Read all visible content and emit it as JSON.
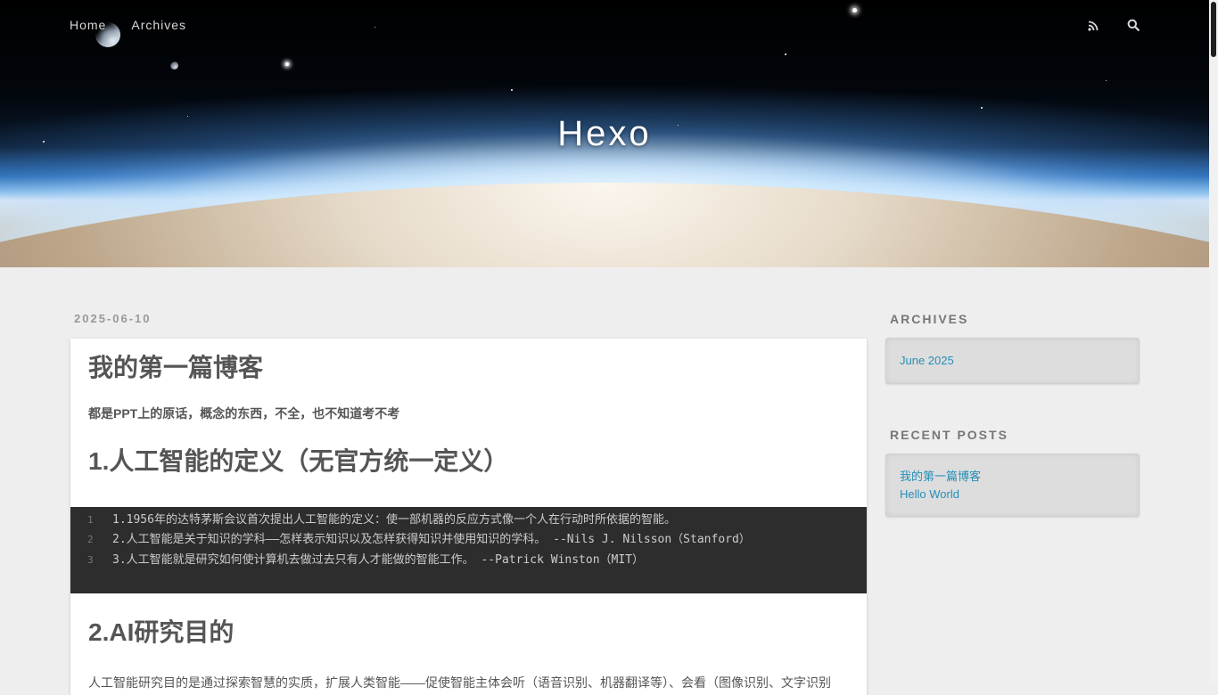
{
  "nav": {
    "home": "Home",
    "archives": "Archives",
    "rss_icon": "rss-icon",
    "search_icon": "search-icon"
  },
  "site": {
    "title": "Hexo"
  },
  "post": {
    "date": "2025-06-10",
    "title": "我的第一篇博客",
    "subtitle": "都是PPT上的原话，概念的东西，不全，也不知道考不考",
    "section1": "1.人工智能的定义（无官方统一定义）",
    "code_lines": [
      {
        "num": "1",
        "text": "1.1956年的达特茅斯会议首次提出人工智能的定义：使一部机器的反应方式像一个人在行动时所依据的智能。"
      },
      {
        "num": "2",
        "text": "2.人工智能是关于知识的学科——怎样表示知识以及怎样获得知识并使用知识的学科。  --Nils J. Nilsson（Stanford）"
      },
      {
        "num": "3",
        "text": "3.人工智能就是研究如何使计算机去做过去只有人才能做的智能工作。 --Patrick Winston（MIT）"
      }
    ],
    "section2": "2.AI研究目的",
    "paragraph": "人工智能研究目的是通过探索智慧的实质，扩展人类智能——促使智能主体会听（语音识别、机器翻译等）、会看（图像识别、文字识别"
  },
  "sidebar": {
    "archives_title": "ARCHIVES",
    "archives": [
      "June 2025"
    ],
    "recent_title": "RECENT POSTS",
    "recent": [
      "我的第一篇博客",
      "Hello World"
    ]
  },
  "colors": {
    "link": "#258fb8",
    "background": "#eeeeee",
    "code_bg": "#2d2d2d"
  }
}
